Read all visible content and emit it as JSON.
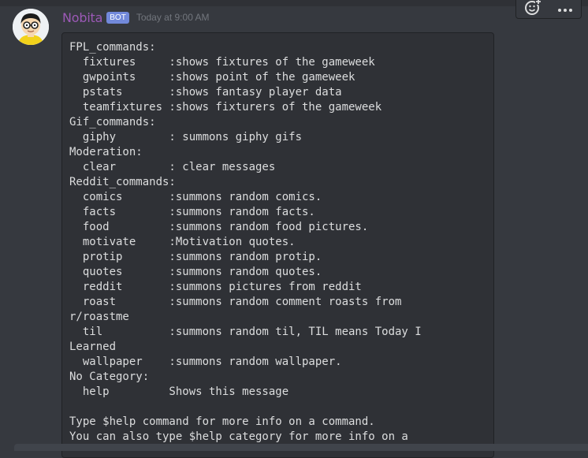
{
  "message": {
    "author": "Nobita",
    "bot_tag": "BOT",
    "timestamp": "Today at 9:00 AM",
    "content": "FPL_commands:\n  fixtures     :shows fixtures of the gameweek\n  gwpoints     :shows point of the gameweek\n  pstats       :shows fantasy player data\n  teamfixtures :shows fixturers of the gameweek\nGif_commands:\n  giphy        : summons giphy gifs\nModeration:\n  clear        : clear messages\nReddit_commands:\n  comics       :summons random comics.\n  facts        :summons random facts.\n  food         :summons random food pictures.\n  motivate     :Motivation quotes.\n  protip       :summons random protip.\n  quotes       :summons random quotes.\n  reddit       :summons pictures from reddit\n  roast        :summons random comment roasts from\nr/roastme\n  til          :summons random til, TIL means Today I\nLearned\n  wallpaper    :summons random wallpaper.\nNo Category:\n  help         Shows this message\n\nType $help command for more info on a command.\nYou can also type $help category for more info on a"
  },
  "toolbar": {
    "add_reaction_icon": "add-reaction-icon",
    "more_icon": "more-icon"
  },
  "colors": {
    "background": "#36393f",
    "code_background": "#2f3136",
    "username": "#9b59b6",
    "bot_tag": "#7289da",
    "text": "#dcddde",
    "timestamp": "#72767d"
  }
}
